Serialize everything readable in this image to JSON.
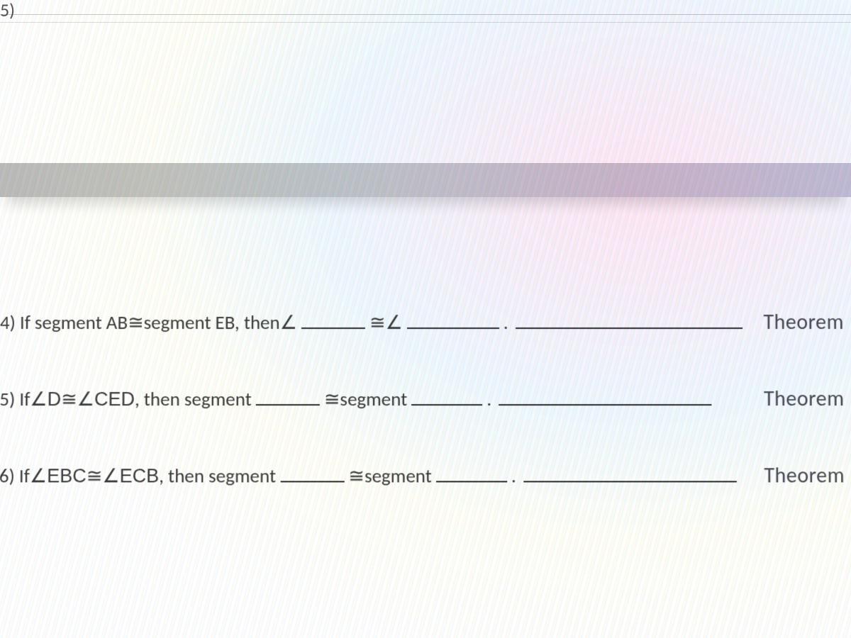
{
  "stray_top": "5)",
  "symbols": {
    "angle": "∠",
    "congruent": "≅"
  },
  "rows": [
    {
      "number": "4)",
      "pre": "If segment AB ",
      "mid1": " segment EB, then ",
      "angle1": "∠",
      "mid2": " ",
      "angle2": "∠",
      "post": ".",
      "theorem": "Theorem"
    },
    {
      "number": "5)",
      "pre": "If ",
      "angleD": "∠D",
      "cong": "≅ ",
      "angleCED": "∠CED",
      "mid1": ", then segment ",
      "word_segment": " segment ",
      "post": ".",
      "theorem": "Theorem"
    },
    {
      "number": "6)",
      "pre": "If ",
      "angleEBC": "∠EBC",
      "cong": "≅ ",
      "angleECB": "∠ECB",
      "mid1": ", then segment ",
      "word_segment": " segment ",
      "post": ".",
      "theorem": "Theorem"
    }
  ]
}
